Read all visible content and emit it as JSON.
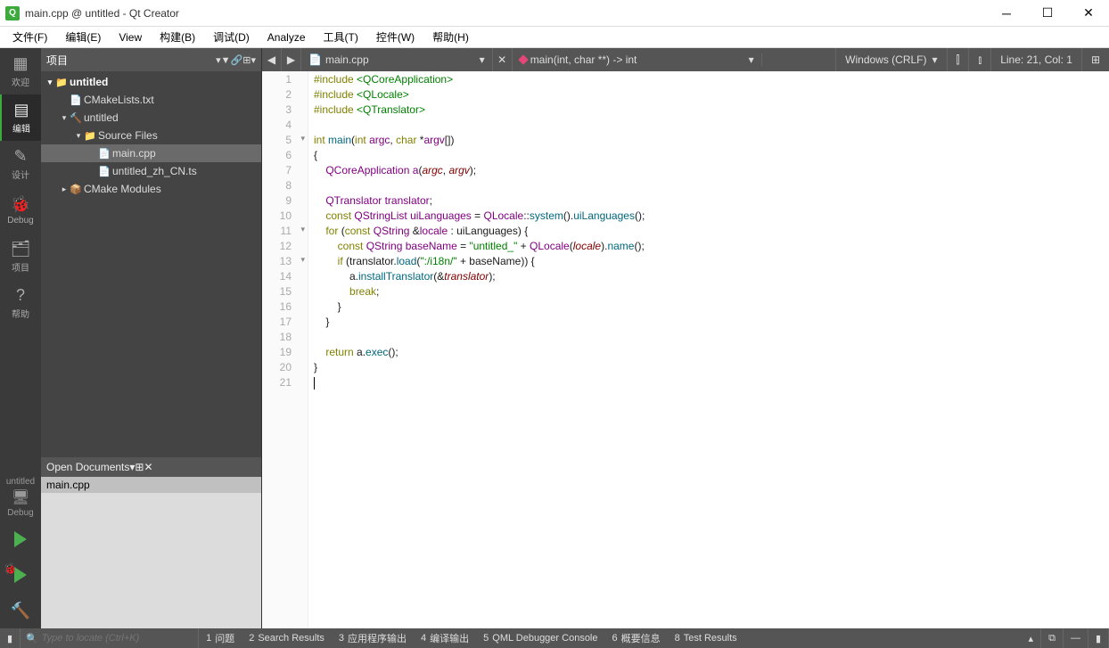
{
  "window": {
    "title": "main.cpp @ untitled - Qt Creator"
  },
  "menus": [
    "文件(F)",
    "编辑(E)",
    "View",
    "构建(B)",
    "调试(D)",
    "Analyze",
    "工具(T)",
    "控件(W)",
    "帮助(H)"
  ],
  "rail": [
    {
      "icon": "▦",
      "label": "欢迎"
    },
    {
      "icon": "▤",
      "label": "编辑",
      "active": true
    },
    {
      "icon": "✎",
      "label": "设计"
    },
    {
      "icon": "🐞",
      "label": "Debug"
    },
    {
      "icon": "🗂",
      "label": "项目"
    },
    {
      "icon": "?",
      "label": "帮助"
    }
  ],
  "kit": {
    "name": "untitled",
    "icon": "🖥",
    "config": "Debug"
  },
  "runbtns": [
    "run",
    "run-debug",
    "build"
  ],
  "projectPanel": {
    "title": "项目",
    "buttons": [
      "▾",
      "▼",
      "🔗",
      "⊞",
      "▾"
    ],
    "tree": [
      {
        "d": 0,
        "tw": "▾",
        "icon": "📁",
        "label": "untitled",
        "bold": true,
        "ifolder": true
      },
      {
        "d": 1,
        "tw": "",
        "icon": "📄",
        "label": "CMakeLists.txt"
      },
      {
        "d": 1,
        "tw": "▾",
        "icon": "🔨",
        "label": "untitled"
      },
      {
        "d": 2,
        "tw": "▾",
        "icon": "📁",
        "label": "Source Files"
      },
      {
        "d": 3,
        "tw": "",
        "icon": "📄",
        "label": "main.cpp",
        "sel": true
      },
      {
        "d": 3,
        "tw": "",
        "icon": "📄",
        "label": "untitled_zh_CN.ts"
      },
      {
        "d": 1,
        "tw": "▸",
        "icon": "📦",
        "label": "CMake Modules"
      }
    ]
  },
  "openDocs": {
    "title": "Open Documents",
    "buttons": [
      "▾",
      "⊞",
      "✕"
    ],
    "items": [
      "main.cpp"
    ]
  },
  "editorTab": {
    "nav": [
      "◀",
      "▶"
    ],
    "fileIcon": "📄",
    "file": "main.cpp",
    "fileDropdown": "▾",
    "close": "✕",
    "symbol": "main(int, char **) -> int",
    "symbolDropdown": "▾",
    "encoding": "Windows (CRLF)",
    "encDropdown": "▾",
    "split": "⫿",
    "splitH": "⫾",
    "position": "Line: 21, Col: 1",
    "extra": "⊞"
  },
  "code": {
    "lines": [
      {
        "n": 1,
        "fold": false,
        "html": "<span class='kw2'>#include</span> <span class='str'>&lt;QCoreApplication&gt;</span>"
      },
      {
        "n": 2,
        "fold": false,
        "html": "<span class='kw2'>#include</span> <span class='str'>&lt;QLocale&gt;</span>"
      },
      {
        "n": 3,
        "fold": false,
        "html": "<span class='kw2'>#include</span> <span class='str'>&lt;QTranslator&gt;</span>"
      },
      {
        "n": 4,
        "fold": false,
        "html": ""
      },
      {
        "n": 5,
        "fold": true,
        "html": "<span class='kw2'>int</span> <span class='func'>main</span>(<span class='kw2'>int</span> <span class='type'>argc</span>, <span class='kw2'>char</span> *<span class='type'>argv</span>[])"
      },
      {
        "n": 6,
        "fold": false,
        "html": "{"
      },
      {
        "n": 7,
        "fold": false,
        "html": "    <span class='type'>QCoreApplication</span> <span class='type'>a</span>(<span class='var'>argc</span>, <span class='var'>argv</span>);"
      },
      {
        "n": 8,
        "fold": false,
        "html": ""
      },
      {
        "n": 9,
        "fold": false,
        "html": "    <span class='type'>QTranslator</span> <span class='type'>translator</span>;"
      },
      {
        "n": 10,
        "fold": false,
        "html": "    <span class='kw2'>const</span> <span class='type'>QStringList</span> <span class='type'>uiLanguages</span> = <span class='type'>QLocale</span>::<span class='func'>system</span>().<span class='func'>uiLanguages</span>();"
      },
      {
        "n": 11,
        "fold": true,
        "html": "    <span class='kw2'>for</span> (<span class='kw2'>const</span> <span class='type'>QString</span> &amp;<span class='type'>locale</span> : uiLanguages) {"
      },
      {
        "n": 12,
        "fold": false,
        "html": "        <span class='kw2'>const</span> <span class='type'>QString</span> <span class='type'>baseName</span> = <span class='str'>\"untitled_\"</span> + <span class='type'>QLocale</span>(<span class='var'>locale</span>).<span class='func'>name</span>();"
      },
      {
        "n": 13,
        "fold": true,
        "html": "        <span class='kw2'>if</span> (translator.<span class='func'>load</span>(<span class='str'>\":/i18n/\"</span> + baseName)) {"
      },
      {
        "n": 14,
        "fold": false,
        "html": "            a.<span class='func'>installTranslator</span>(&amp;<span class='var'>translator</span>);"
      },
      {
        "n": 15,
        "fold": false,
        "html": "            <span class='kw2'>break</span>;"
      },
      {
        "n": 16,
        "fold": false,
        "html": "        }"
      },
      {
        "n": 17,
        "fold": false,
        "html": "    }"
      },
      {
        "n": 18,
        "fold": false,
        "html": ""
      },
      {
        "n": 19,
        "fold": false,
        "html": "    <span class='kw2'>return</span> a.<span class='func'>exec</span>();"
      },
      {
        "n": 20,
        "fold": false,
        "html": "}"
      },
      {
        "n": 21,
        "fold": false,
        "html": "<span class='cursor'></span>"
      }
    ]
  },
  "statusbar": {
    "toggle": "▮",
    "searchPlaceholder": "Type to locate (Ctrl+K)",
    "items": [
      {
        "n": "1",
        "label": "问题"
      },
      {
        "n": "2",
        "label": "Search Results"
      },
      {
        "n": "3",
        "label": "应用程序输出"
      },
      {
        "n": "4",
        "label": "编译输出"
      },
      {
        "n": "5",
        "label": "QML Debugger Console"
      },
      {
        "n": "6",
        "label": "概要信息"
      },
      {
        "n": "8",
        "label": "Test Results"
      }
    ],
    "right": [
      "▴",
      "⧉",
      "—",
      "▮"
    ]
  }
}
